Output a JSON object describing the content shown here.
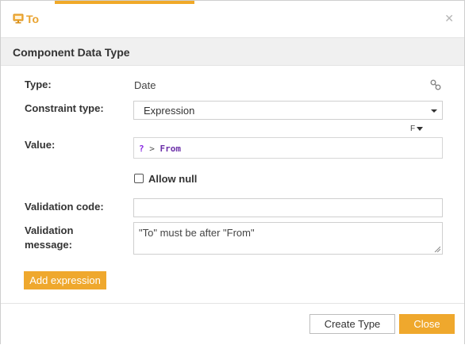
{
  "dialog": {
    "title": "To",
    "title_icon": "monitor-icon",
    "close_icon": "close-icon",
    "accent_color": "#efa82d"
  },
  "section": {
    "title": "Component Data Type"
  },
  "form": {
    "type_label": "Type:",
    "type_value": "Date",
    "type_link_icon": "link-icon",
    "constraint_label": "Constraint type:",
    "constraint_value": "Expression",
    "fx_toggle_label": "F",
    "value_label": "Value:",
    "value_tokens": {
      "q": "?",
      "op": ">",
      "id": "From"
    },
    "allow_null_label": "Allow null",
    "allow_null_checked": false,
    "validation_code_label": "Validation code:",
    "validation_code_value": "",
    "validation_message_label_line1": "Validation",
    "validation_message_label_line2": "message:",
    "validation_message_value": "\"To\" must be after \"From\""
  },
  "actions": {
    "add_expression": "Add expression",
    "create_type": "Create Type",
    "close": "Close"
  }
}
